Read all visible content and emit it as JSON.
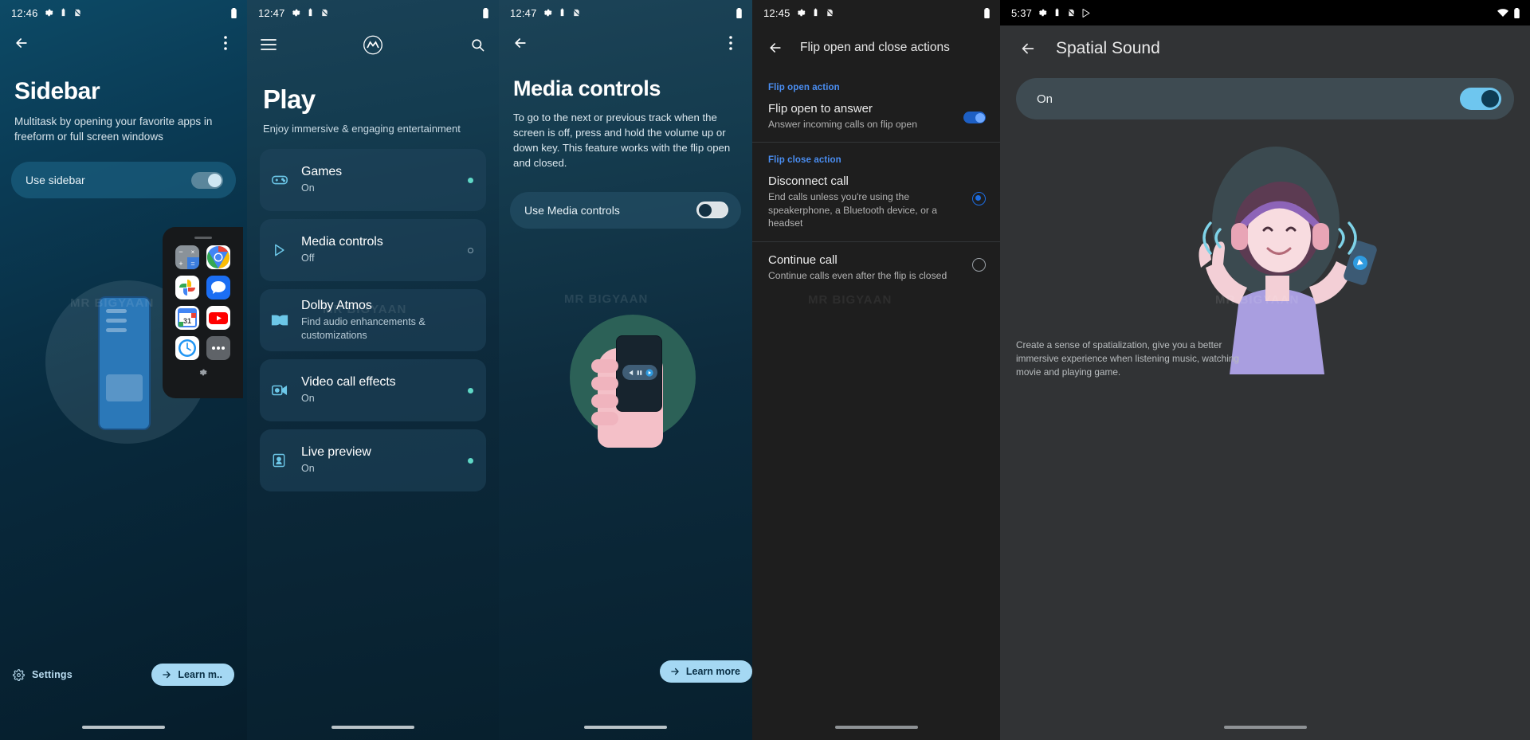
{
  "panels": {
    "sidebar": {
      "status": {
        "time": "12:46",
        "icons": [
          "gear-icon",
          "vibrate-icon",
          "no-sim-icon"
        ],
        "battery": "battery-icon"
      },
      "back_icon": "arrow-back-icon",
      "overflow_icon": "more-vert-icon",
      "title": "Sidebar",
      "subtitle": "Multitask by opening your favorite apps in freeform or full screen windows",
      "toggle": {
        "label": "Use sidebar",
        "state": "on"
      },
      "settings_label": "Settings",
      "settings_icon": "gear-icon",
      "learn_more_label": "Learn m..",
      "learn_more_icon": "arrow-forward-icon",
      "dock_apps": [
        "calculator-icon",
        "chrome-icon",
        "google-photos-icon",
        "messages-icon",
        "google-calendar-icon",
        "youtube-icon",
        "clock-icon",
        "more-apps-icon"
      ],
      "dock_settings_icon": "gear-icon",
      "watermark": "MR BIGYAAN"
    },
    "play": {
      "status": {
        "time": "12:47",
        "icons": [
          "gear-icon",
          "vibrate-icon",
          "no-sim-icon"
        ],
        "battery": "battery-icon"
      },
      "menu_icon": "hamburger-menu-icon",
      "brand_icon": "motorola-logo-icon",
      "search_icon": "search-icon",
      "title": "Play",
      "subtitle": "Enjoy immersive & engaging entertainment",
      "items": [
        {
          "icon": "gamepad-icon",
          "title": "Games",
          "subtitle": "On",
          "status": "on"
        },
        {
          "icon": "play-triangle-icon",
          "title": "Media controls",
          "subtitle": "Off",
          "status": "off"
        },
        {
          "icon": "dolby-icon",
          "title": "Dolby Atmos",
          "subtitle": "Find audio enhancements & customizations",
          "status": "none"
        },
        {
          "icon": "video-effects-icon",
          "title": "Video call effects",
          "subtitle": "On",
          "status": "on"
        },
        {
          "icon": "live-preview-icon",
          "title": "Live preview",
          "subtitle": "On",
          "status": "on"
        }
      ],
      "watermark": "MR BIGYAAN"
    },
    "media_controls": {
      "status": {
        "time": "12:47",
        "icons": [
          "gear-icon",
          "vibrate-icon",
          "no-sim-icon"
        ],
        "battery": "battery-icon"
      },
      "back_icon": "arrow-back-icon",
      "overflow_icon": "more-vert-icon",
      "title": "Media controls",
      "body": "To go to the next or previous track when the screen is off, press and hold the volume up or down key. This feature works with the flip open and closed.",
      "toggle": {
        "label": "Use Media controls",
        "state": "off"
      },
      "learn_more_label": "Learn more",
      "learn_more_icon": "arrow-forward-icon",
      "watermark": "MR BIGYAAN"
    },
    "flip_actions": {
      "status": {
        "time": "12:45",
        "icons": [
          "gear-icon",
          "vibrate-icon",
          "no-sim-icon"
        ],
        "battery": "battery-icon"
      },
      "back_icon": "arrow-back-icon",
      "title": "Flip open and close actions",
      "section_open": "Flip open action",
      "open_option": {
        "title": "Flip open to answer",
        "subtitle": "Answer incoming calls on flip open",
        "control": "switch",
        "state": "on"
      },
      "section_close": "Flip close action",
      "close_options": [
        {
          "title": "Disconnect call",
          "subtitle": "End calls unless you're using the speakerphone, a Bluetooth device, or a headset",
          "control": "radio",
          "selected": true
        },
        {
          "title": "Continue call",
          "subtitle": "Continue calls even after the flip is closed",
          "control": "radio",
          "selected": false
        }
      ],
      "watermark": "MR BIGYAAN"
    },
    "spatial_sound": {
      "status": {
        "time": "5:37",
        "icons": [
          "gear-icon",
          "vibrate-icon",
          "no-sim-icon",
          "play-store-icon"
        ],
        "right_icons": [
          "wifi-icon",
          "battery-icon"
        ]
      },
      "back_icon": "arrow-back-icon",
      "title": "Spatial Sound",
      "toggle": {
        "label": "On",
        "state": "on"
      },
      "description": "Create a sense of spatialization, give you a better immersive experience when listening music, watching movie and playing game.",
      "illustration": "woman-with-headphones-illustration",
      "watermark": "MR BIGYAAN"
    }
  },
  "colors": {
    "accent_blue": "#4a8df0",
    "toggle_on_light": "#6ec6ef",
    "status_dot_on": "#5fd8c6",
    "learn_more_bg": "#a5d8f3",
    "radio_selected": "#1d6ce0"
  }
}
